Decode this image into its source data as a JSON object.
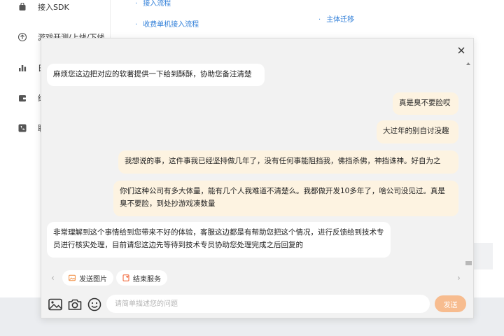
{
  "sidebar": {
    "items": [
      {
        "label": "接入SDK",
        "icon": "bag-icon"
      },
      {
        "label": "游戏开测/上线/下线",
        "icon": "rocket-icon"
      },
      {
        "label": "日",
        "icon": "bar-chart-icon"
      },
      {
        "label": "结",
        "icon": "wallet-icon"
      },
      {
        "label": "联",
        "icon": "phone-icon"
      }
    ]
  },
  "doc_links": {
    "col1": [
      "接入流程",
      "收费单机接入流程"
    ],
    "col2": [
      "主体迁移"
    ]
  },
  "chat": {
    "messages": [
      {
        "side": "left",
        "text": "麻烦您这边把对应的软著提供一下给到酥酥，协助您备注清楚"
      },
      {
        "side": "right",
        "text": "真是臭不要脸哎"
      },
      {
        "side": "right",
        "text": "大过年的别自讨没趣"
      },
      {
        "side": "right",
        "text": "我想说的事，这件事我已经坚持做几年了，没有任何事能阻挡我，佛挡杀佛，神挡诛神。好自为之"
      },
      {
        "side": "right",
        "text": "你们这种公司有多大体量，能有几个人我难道不清楚么。我都做开发10多年了，啥公司没见过。真是臭不要脸，到处抄游戏凑数量"
      },
      {
        "side": "left",
        "text": "非常理解到这个事情给到您带来不好的体验，客服这边都是有帮助您把这个情况，进行反馈给到技术专员进行核实处理，目前请您这边先等待到技术专员协助您处理完成之后回复的"
      }
    ],
    "quick_actions": [
      {
        "label": "发送图片",
        "icon": "image-icon",
        "color": "#f08a3c"
      },
      {
        "label": "结束服务",
        "icon": "end-service-icon",
        "color": "#f05a28"
      }
    ],
    "input": {
      "placeholder": "请简单描述您的问题",
      "value": ""
    },
    "send_label": "发送",
    "accent_color": "#f7bc8f"
  }
}
